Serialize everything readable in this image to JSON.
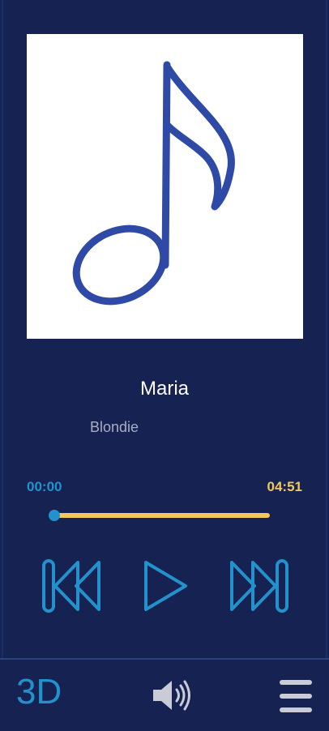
{
  "track": {
    "title": "Maria",
    "artist": "Blondie"
  },
  "player": {
    "current_time": "00:00",
    "total_time": "04:51",
    "progress_fraction": 0.0
  },
  "controls": {
    "previous_icon": "skip-previous-icon",
    "play_icon": "play-icon",
    "next_icon": "skip-next-icon"
  },
  "bottom_bar": {
    "mode_label": "3D",
    "volume_icon": "speaker-icon",
    "menu_icon": "hamburger-menu-icon"
  },
  "colors": {
    "background": "#152252",
    "accent_blue": "#2392cc",
    "accent_yellow": "#f2c95c",
    "note_blue": "#2f4aa6"
  }
}
